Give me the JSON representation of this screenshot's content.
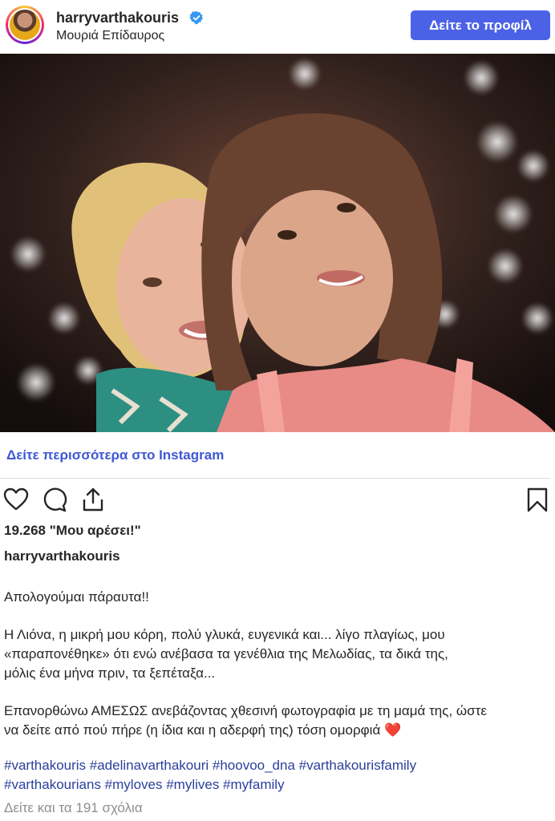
{
  "header": {
    "username": "harryvarthakouris",
    "location": "Μουριά Επίδαυρος",
    "profile_button": "Δείτε το προφίλ"
  },
  "post": {
    "more_link": "Δείτε περισσότερα στο Instagram",
    "likes": "19.268 \"Μου αρέσει!\"",
    "caption_user": "harryvarthakouris",
    "caption_lines": [
      "Απολογούμαι πάραυτα!!",
      "Η Λιόνα, η μικρή μου κόρη, πολύ γλυκά, ευγενικά και... λίγο πλαγίως, μου",
      "«παραπονέθηκε» ότι ενώ ανέβασα τα γενέθλια της Μελωδίας, τα δικά της,",
      "μόλις ένα μήνα πριν, τα ξεπέταξα...",
      "Επανορθώνω ΑΜΕΣΩΣ ανεβάζοντας χθεσινή φωτογραφία με τη μαμά της, ώστε",
      "να δείτε από πού πήρε (η ίδια και η αδερφή της) τόση ομορφιά ❤️"
    ],
    "hashtags_line1": "#varthakouris #adelinavarthakouri #hoovoo_dna #varthakourisfamily",
    "hashtags_line2": "#varthakourians #myloves #mylives #myfamily",
    "comments_link": "Δείτε και τα 191 σχόλια"
  },
  "colors": {
    "accent": "#4b62e6",
    "link": "#3f58d4",
    "hashtag": "#2b3f9b",
    "muted": "#8e8e8e"
  },
  "icons": [
    "verified-badge-icon",
    "heart-icon",
    "comment-icon",
    "share-icon",
    "bookmark-icon"
  ]
}
